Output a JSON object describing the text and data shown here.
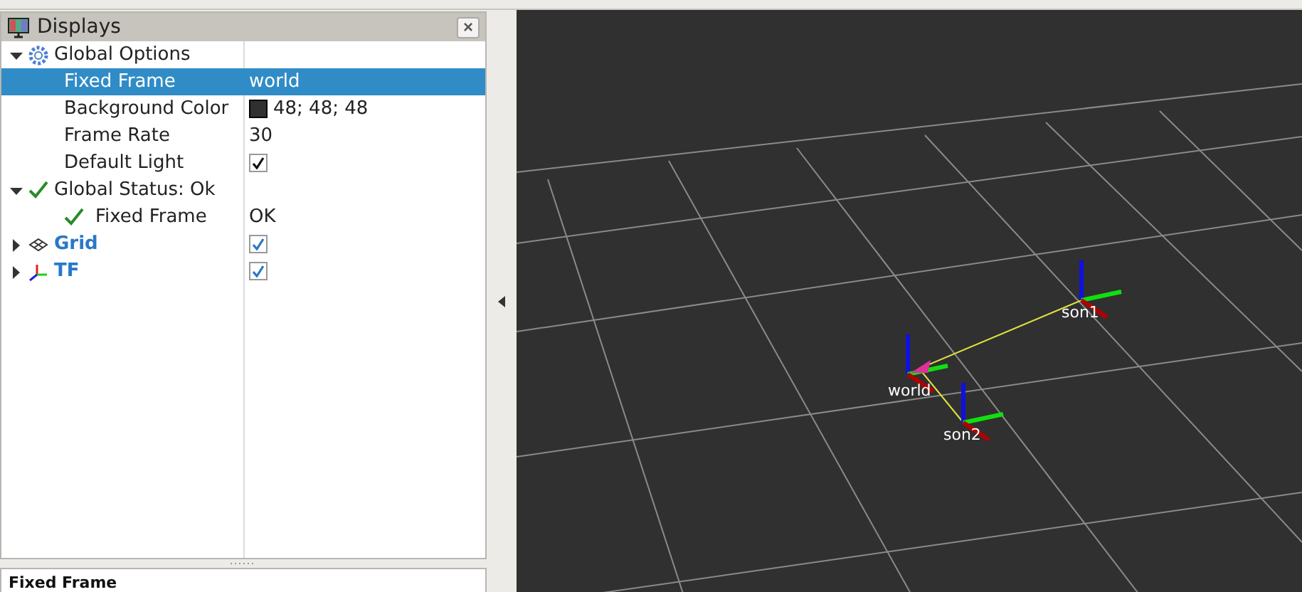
{
  "displays_panel": {
    "title": "Displays",
    "close_label": "×",
    "tree": [
      {
        "kind": "options",
        "label": "Global Options",
        "expanded": true,
        "children": [
          {
            "label": "Fixed Frame",
            "value": "world",
            "selected": true
          },
          {
            "label": "Background Color",
            "value": "48; 48; 48",
            "color": "#303030",
            "selected": false
          },
          {
            "label": "Frame Rate",
            "value": "30",
            "selected": false
          },
          {
            "label": "Default Light",
            "checked": true,
            "selected": false
          }
        ]
      },
      {
        "kind": "status",
        "label": "Global Status: Ok",
        "expanded": true,
        "children": [
          {
            "label": "Fixed Frame",
            "value": "OK",
            "status": true,
            "selected": false
          }
        ]
      },
      {
        "kind": "grid",
        "label": "Grid",
        "expanded": false,
        "checked": true
      },
      {
        "kind": "tf",
        "label": "TF",
        "expanded": false,
        "checked": true
      }
    ]
  },
  "lower_panel": {
    "title": "Fixed Frame"
  },
  "viewport": {
    "frames": [
      {
        "label": "son1"
      },
      {
        "label": "world"
      },
      {
        "label": "son2"
      }
    ]
  }
}
